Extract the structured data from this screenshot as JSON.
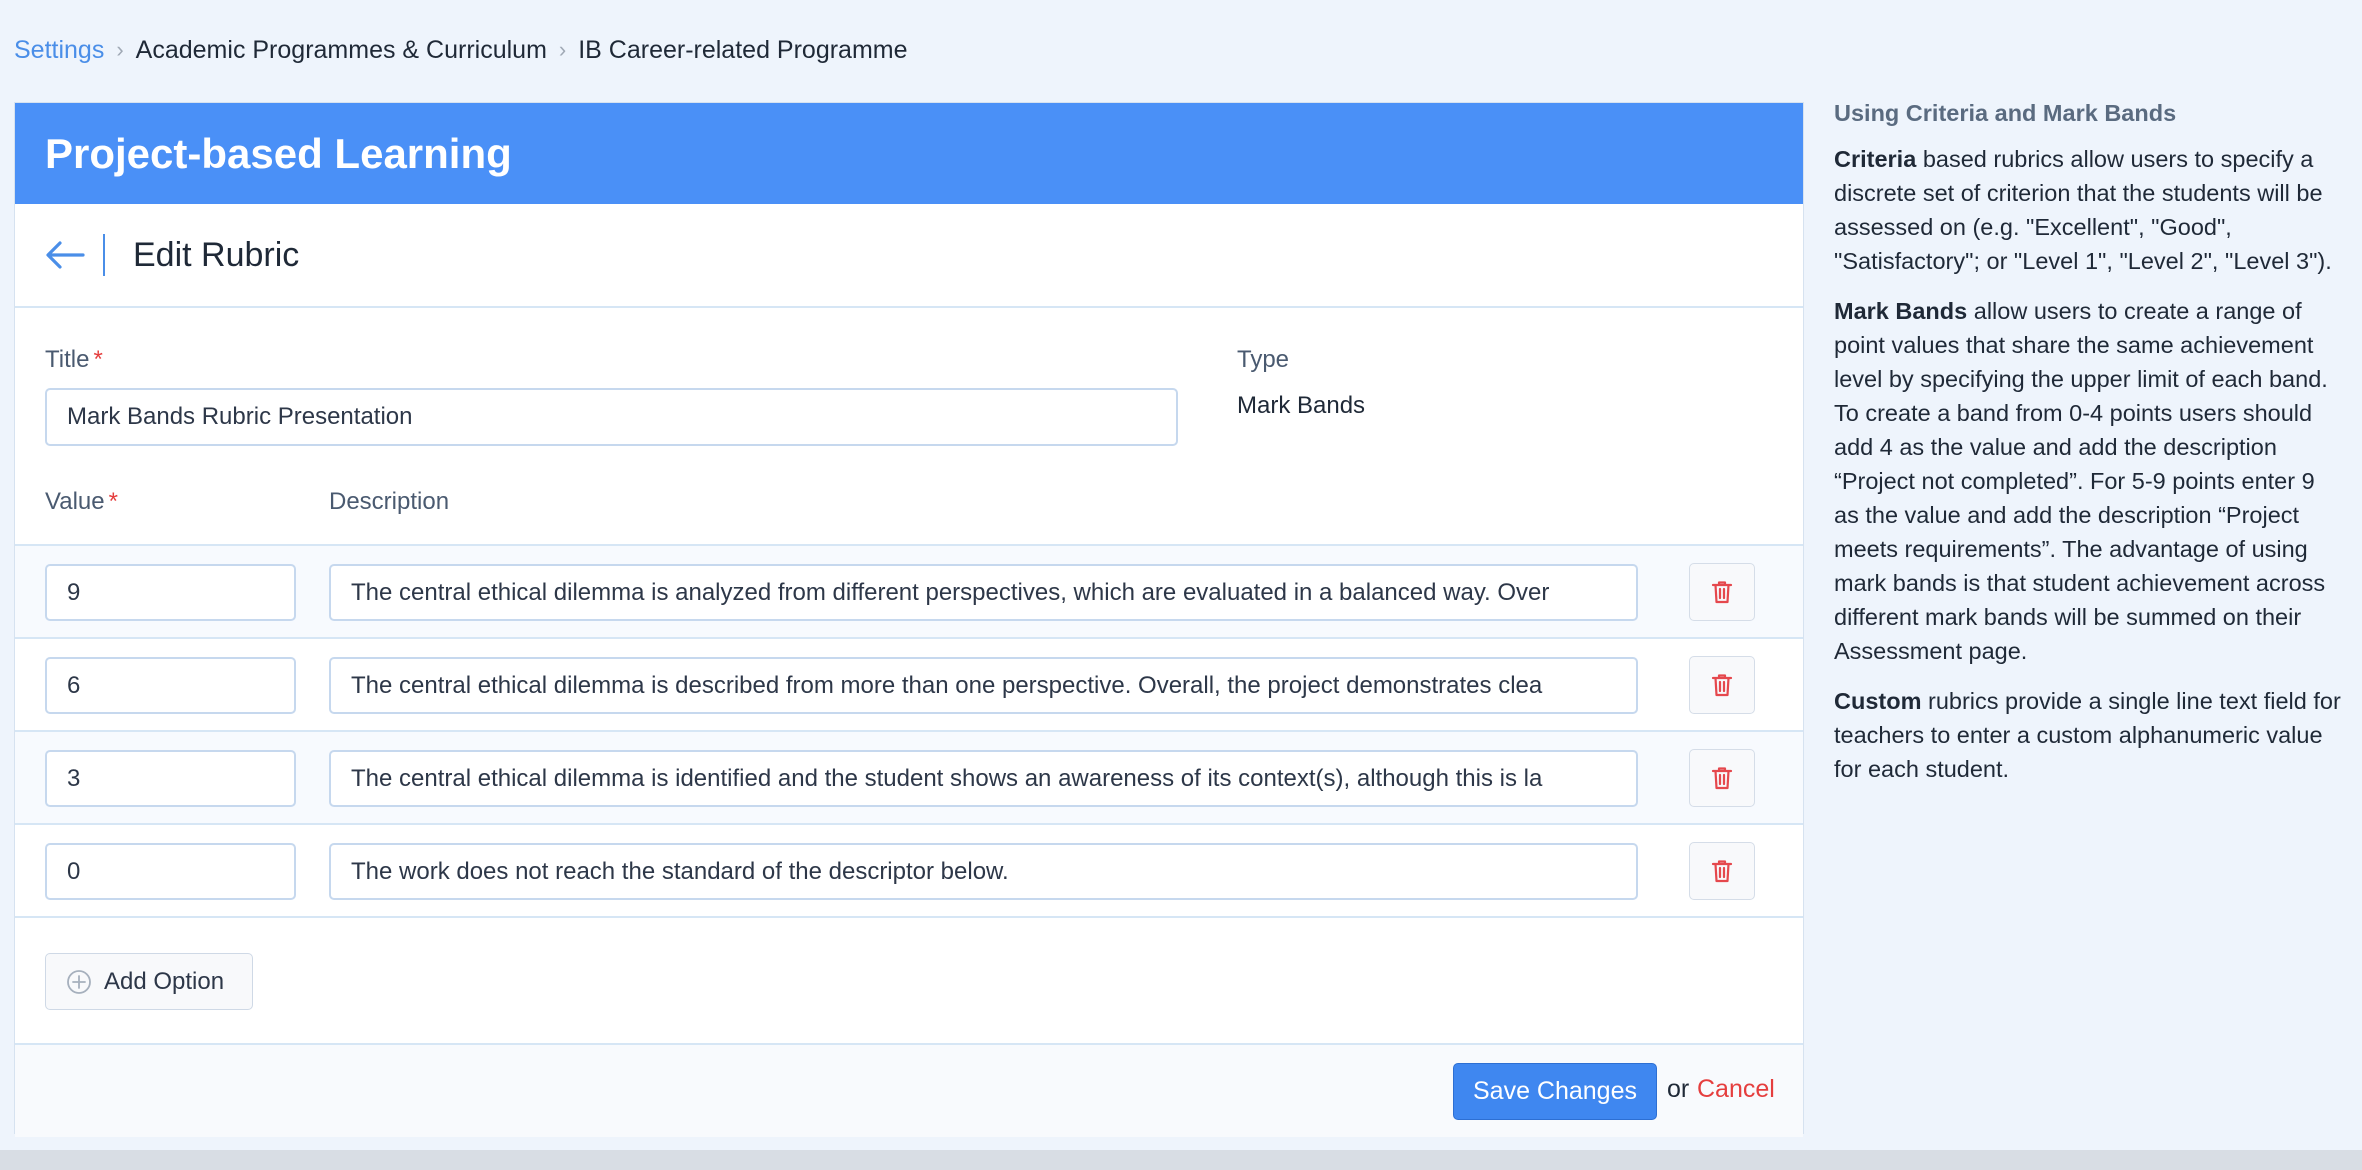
{
  "breadcrumb": {
    "items": [
      "Settings",
      "Academic Programmes & Curriculum",
      "IB Career-related Programme"
    ],
    "separator": "›"
  },
  "card": {
    "header_title": "Project-based Learning",
    "edit_title": "Edit Rubric"
  },
  "form": {
    "title_label": "Title",
    "required_mark": "*",
    "title_value": "Mark Bands Rubric Presentation",
    "type_label": "Type",
    "type_value": "Mark Bands",
    "value_label": "Value",
    "description_label": "Description"
  },
  "rows": [
    {
      "value": "9",
      "description": "The central ethical dilemma is analyzed from different perspectives, which are evaluated in a balanced way. Over"
    },
    {
      "value": "6",
      "description": "The central ethical dilemma is described from more than one perspective. Overall, the project demonstrates clea"
    },
    {
      "value": "3",
      "description": "The central ethical dilemma is identified and the student shows an awareness of its context(s), although this is la"
    },
    {
      "value": "0",
      "description": "The work does not reach the standard of the descriptor below."
    }
  ],
  "add_option_label": "Add Option",
  "footer": {
    "save_label": "Save Changes",
    "or_text": "or",
    "cancel_label": "Cancel"
  },
  "help": {
    "title": "Using Criteria and Mark Bands",
    "criteria_term": "Criteria",
    "criteria_text": " based rubrics allow users to specify a discrete set of criterion that the students will be assessed on (e.g. \"Excellent\", \"Good\", \"Satisfactory\"; or \"Level 1\", \"Level 2\", \"Level 3\").",
    "markbands_term": "Mark Bands",
    "markbands_text": " allow users to create a range of point values that share the same achievement level by specifying the upper limit of each band. To create a band from 0-4 points users should add 4 as the value and add the description “Project not completed”. For 5-9 points enter 9 as the value and add the description “Project meets requirements”. The advantage of using mark bands is that student achievement across different mark bands will be summed on their Assessment page.",
    "custom_term": "Custom",
    "custom_text": " rubrics provide a single line text field for teachers to enter a custom alphanumeric value for each student."
  },
  "colors": {
    "accent": "#4a90f7",
    "link": "#4a8ee8",
    "danger": "#e53e3e",
    "background": "#eef4fc"
  },
  "icons": {
    "back": "arrow-left-icon",
    "delete": "trash-icon",
    "add": "plus-circle-icon",
    "breadcrumb_separator": "chevron-right-icon"
  }
}
